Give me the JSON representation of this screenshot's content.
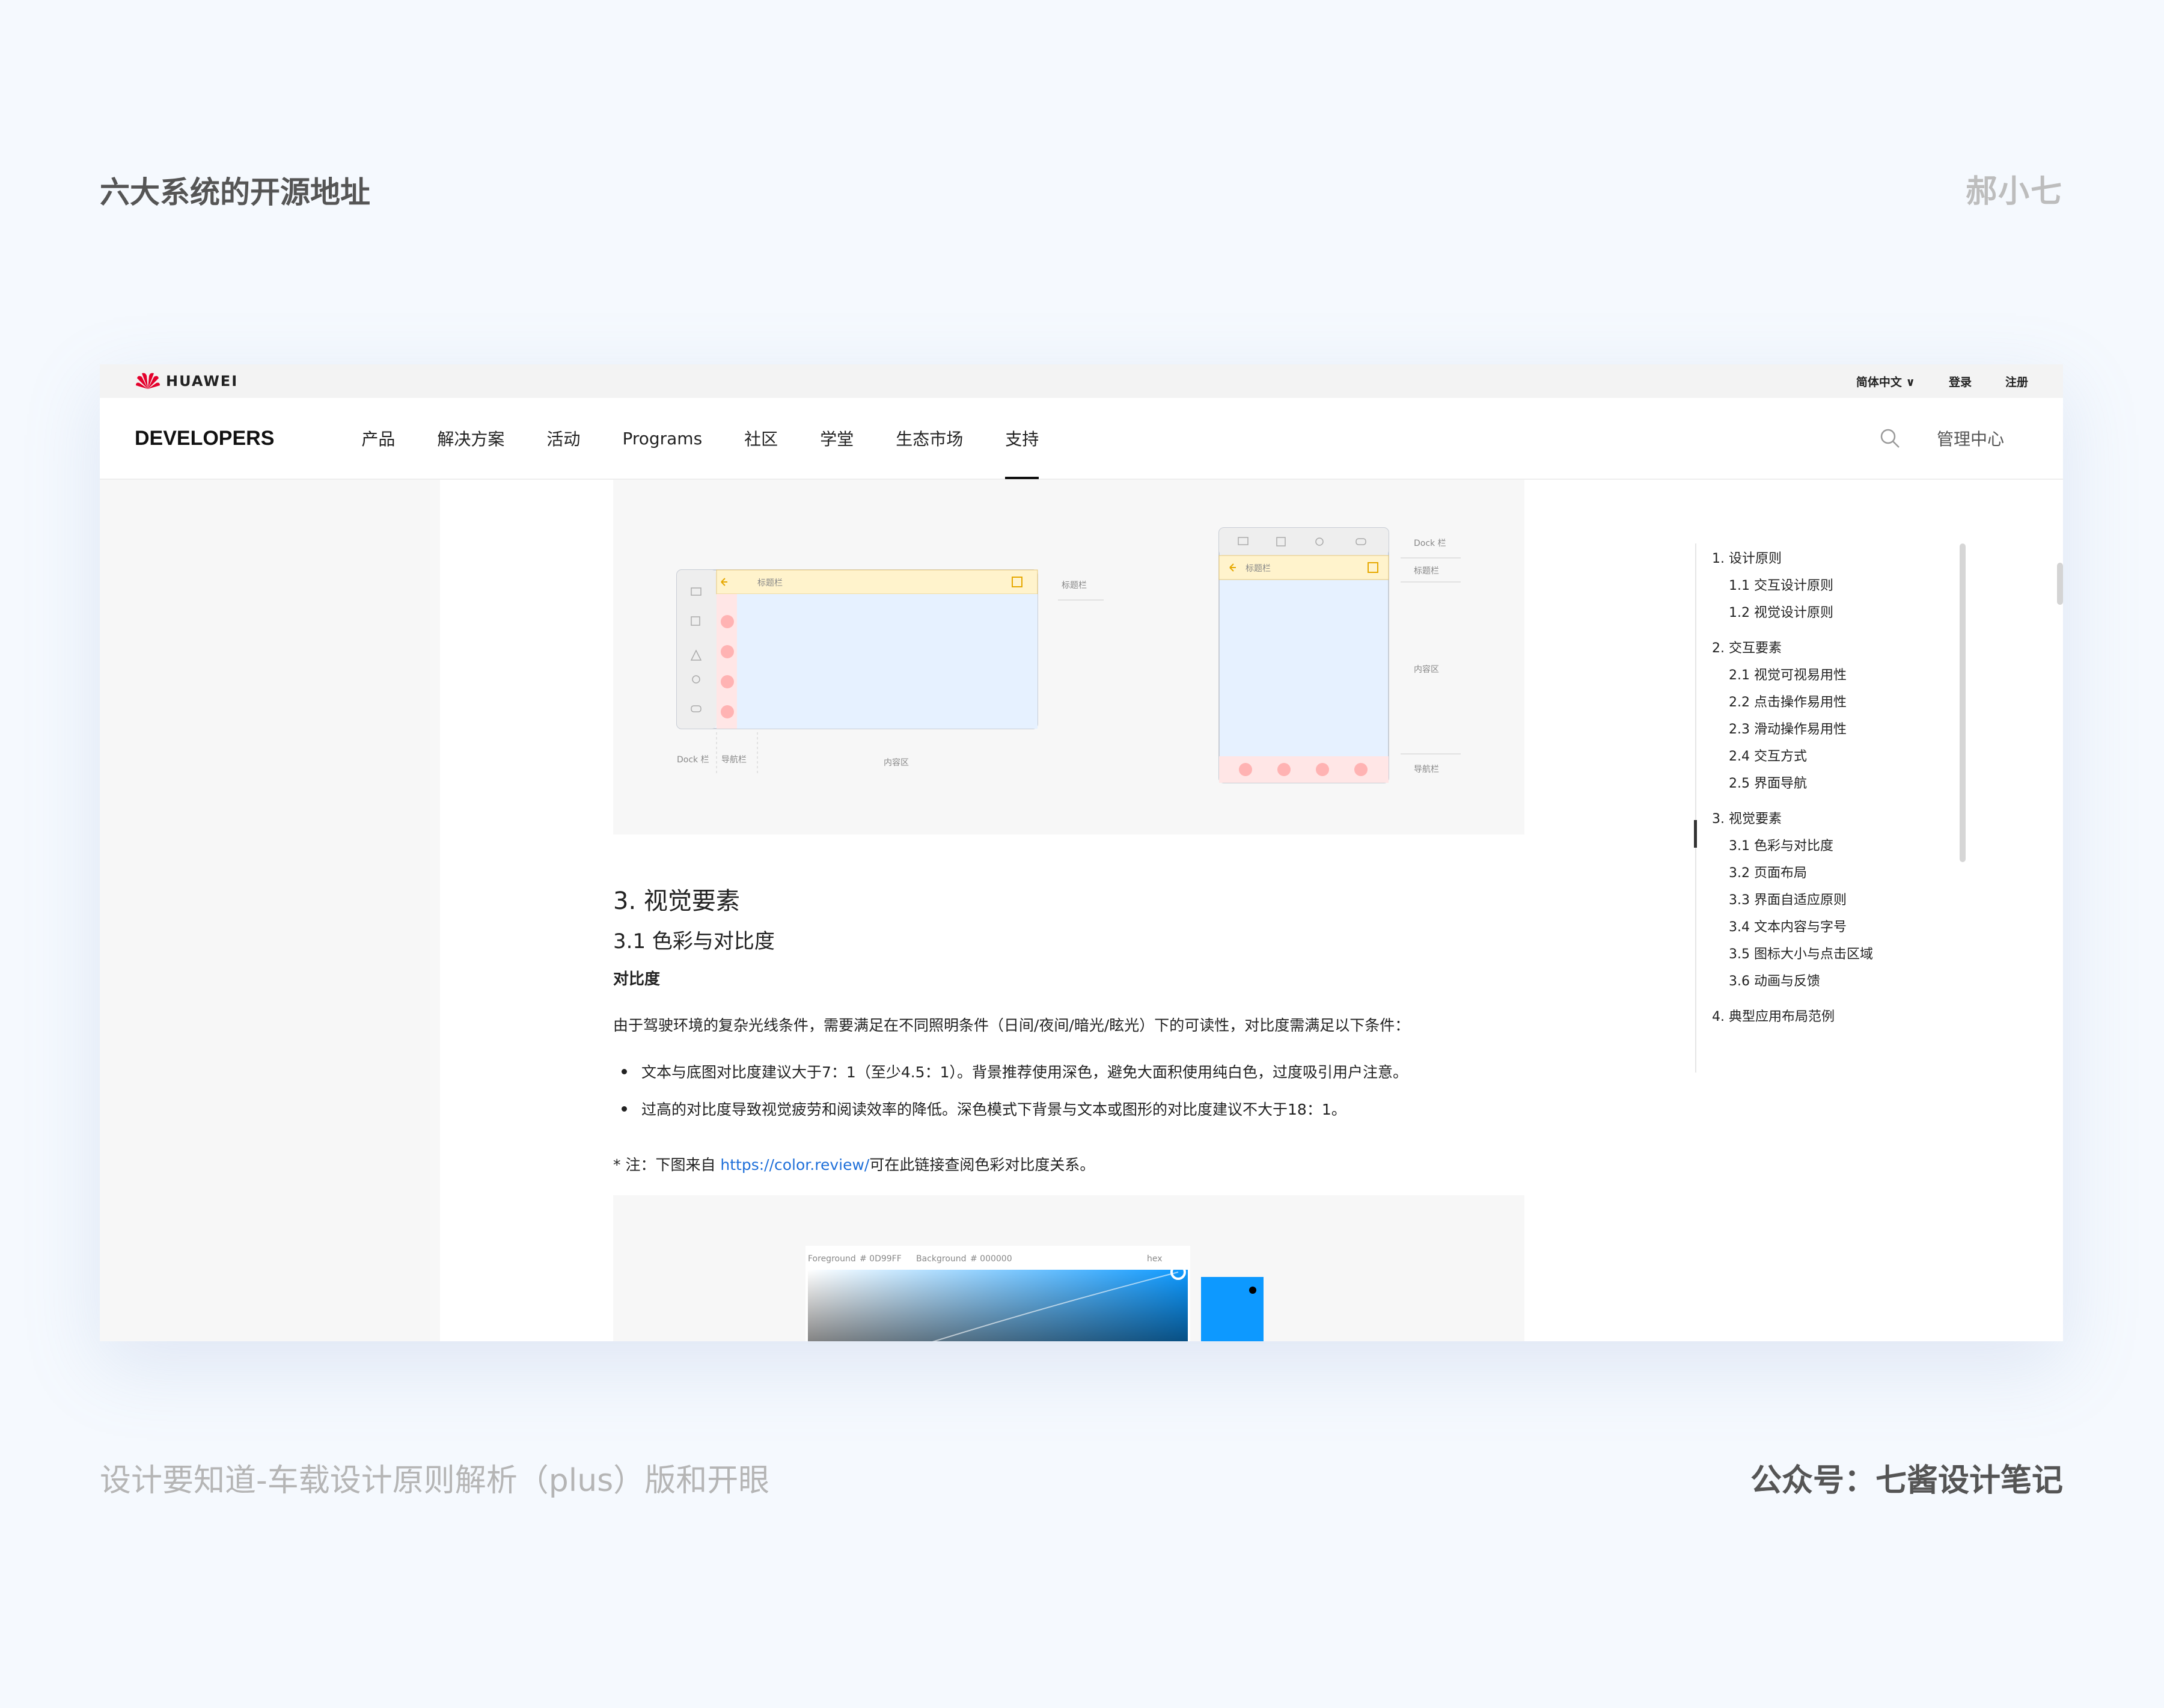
{
  "header": {
    "title": "六大系统的开源地址",
    "author": "郝小七"
  },
  "footer": {
    "caption_left": "设计要知道-车载设计原则解析（plus）版和开眼",
    "caption_right": "公众号：七酱设计笔记"
  },
  "site": {
    "logo_text": "HUAWEI",
    "brand": "DEVELOPERS",
    "lang": "简体中文 ∨",
    "login": "登录",
    "register": "注册",
    "menu": [
      "产品",
      "解决方案",
      "活动",
      "Programs",
      "社区",
      "学堂",
      "生态市场",
      "支持"
    ],
    "admin": "管理中心"
  },
  "diagram": {
    "title_bar": "标题栏",
    "dock": "Dock 栏",
    "nav_bar": "导航栏",
    "content_area": "内容区"
  },
  "article": {
    "h3": "3. 视觉要素",
    "h31": "3.1 色彩与对比度",
    "h4": "对比度",
    "para": "由于驾驶环境的复杂光线条件，需要满足在不同照明条件（日间/夜间/暗光/眩光）下的可读性，对比度需满足以下条件：",
    "bullets": [
      "文本与底图对比度建议大于7：1（至少4.5：1）。背景推荐使用深色，避免大面积使用纯白色，过度吸引用户注意。",
      "过高的对比度导致视觉疲劳和阅读效率的降低。深色模式下背景与文本或图形的对比度建议不大于18：1。"
    ],
    "note_prefix": "* 注：下图来自 ",
    "note_link": "https://color.review/",
    "note_suffix": "可在此链接查阅色彩对比度关系。"
  },
  "color_tool": {
    "foreground_label": "Foreground",
    "foreground_value": "# 0D99FF",
    "background_label": "Background",
    "background_value": "# 000000",
    "format": "hex"
  },
  "toc": {
    "items": [
      {
        "label": "1. 设计原则",
        "level": 1
      },
      {
        "label": "1.1 交互设计原则",
        "level": 2
      },
      {
        "label": "1.2 视觉设计原则",
        "level": 2
      },
      {
        "label": "2. 交互要素",
        "level": 1
      },
      {
        "label": "2.1 视觉可视易用性",
        "level": 2
      },
      {
        "label": "2.2 点击操作易用性",
        "level": 2
      },
      {
        "label": "2.3 滑动操作易用性",
        "level": 2
      },
      {
        "label": "2.4 交互方式",
        "level": 2
      },
      {
        "label": "2.5 界面导航",
        "level": 2
      },
      {
        "label": "3. 视觉要素",
        "level": 1
      },
      {
        "label": "3.1 色彩与对比度",
        "level": 2
      },
      {
        "label": "3.2 页面布局",
        "level": 2
      },
      {
        "label": "3.3 界面自适应原则",
        "level": 2
      },
      {
        "label": "3.4 文本内容与字号",
        "level": 2
      },
      {
        "label": "3.5 图标大小与点击区域",
        "level": 2
      },
      {
        "label": "3.6 动画与反馈",
        "level": 2
      },
      {
        "label": "4. 典型应用布局范例",
        "level": 1
      }
    ]
  },
  "colors": {
    "background": "#f5f9fe",
    "accent_yellow": "#fff3cc",
    "accent_blue": "#e6f1ff",
    "dot_red": "#ffb3b3",
    "link": "#1e6fd9",
    "swatch": "#0D99FF"
  }
}
